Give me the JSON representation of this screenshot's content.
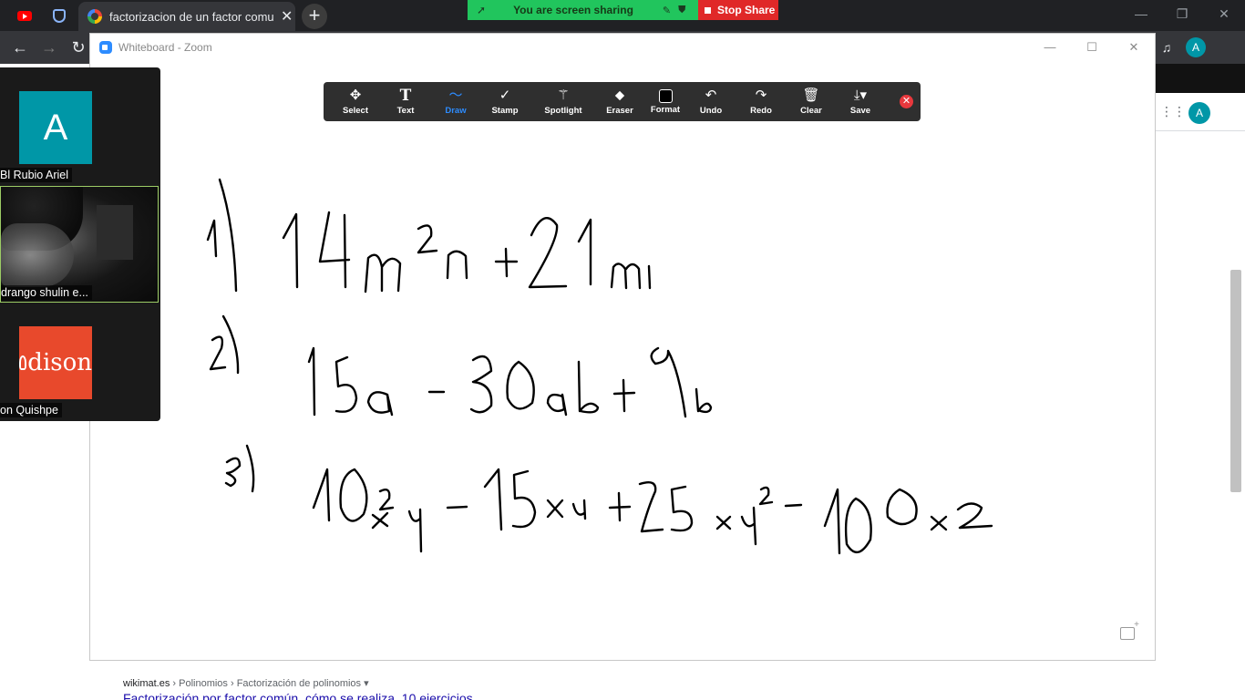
{
  "browser": {
    "active_tab_title": "factorizacion de un factor comun",
    "tab_close": "✕",
    "new_tab": "+",
    "profile_initial": "A"
  },
  "share_banner": {
    "status_text": "You are screen sharing",
    "stop_label": "Stop Share"
  },
  "whiteboard": {
    "window_title": "Whiteboard - Zoom",
    "tools": [
      {
        "label": "Select",
        "icon": "move-icon"
      },
      {
        "label": "Text",
        "icon": "text-icon"
      },
      {
        "label": "Draw",
        "icon": "draw-icon"
      },
      {
        "label": "Stamp",
        "icon": "stamp-icon"
      },
      {
        "label": "Spotlight",
        "icon": "spotlight-icon"
      },
      {
        "label": "Eraser",
        "icon": "eraser-icon"
      },
      {
        "label": "Format",
        "icon": "format-icon"
      },
      {
        "label": "Undo",
        "icon": "undo-icon"
      },
      {
        "label": "Redo",
        "icon": "redo-icon"
      },
      {
        "label": "Clear",
        "icon": "trash-icon"
      },
      {
        "label": "Save",
        "icon": "save-icon"
      }
    ],
    "active_tool": "Draw",
    "exercises": [
      {
        "number": "1)",
        "expression": "14m²n + 21mn"
      },
      {
        "number": "2)",
        "expression": "15a − 30ab + 9b"
      },
      {
        "number": "3)",
        "expression": "10x²y − 15xy + 25xy² − 100x2"
      }
    ]
  },
  "participants": [
    {
      "name": "Bl Rubio Ariel",
      "avatar_initial": "A",
      "avatar_color": "#0097a7"
    },
    {
      "name": "drango shulin e..."
    },
    {
      "name": "on Quishpe",
      "logo_text": "dison",
      "logo_color": "#e8492c"
    }
  ],
  "search_result": {
    "site": "wikimat.es",
    "breadcrumb": " › Polinomios › Factorización de polinomios ▾",
    "title": "Factorización por factor común, cómo se realiza. 10 ejercicios"
  }
}
